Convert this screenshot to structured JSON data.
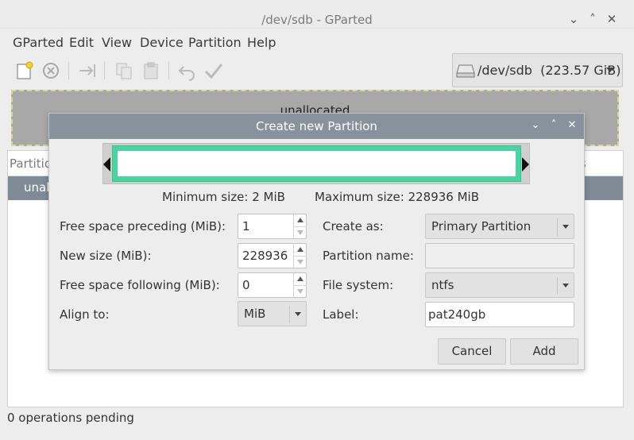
{
  "window": {
    "title": "/dev/sdb - GParted",
    "minimize": "⌄",
    "maximize": "˄",
    "close": "✕"
  },
  "menu": {
    "items": [
      "GParted",
      "Edit",
      "View",
      "Device",
      "Partition",
      "Help"
    ]
  },
  "toolbar": {
    "icons": [
      "new-icon",
      "delete-icon",
      "resize-move-icon",
      "copy-icon",
      "paste-icon",
      "undo-icon",
      "apply-icon"
    ]
  },
  "device": {
    "label": "/dev/sdb  (223.57 GiB)"
  },
  "disk_graphic": {
    "label": "unallocated"
  },
  "list": {
    "header_partition": "Partitio",
    "header_right": "s",
    "row_label": "unal"
  },
  "status": {
    "text": "0 operations pending"
  },
  "dialog": {
    "title": "Create new Partition",
    "min_size": "Minimum size: 2 MiB",
    "max_size": "Maximum size: 228936 MiB",
    "free_preceding_label": "Free space preceding (MiB):",
    "free_preceding_value": "1",
    "new_size_label": "New size (MiB):",
    "new_size_value": "228936",
    "free_following_label": "Free space following (MiB):",
    "free_following_value": "0",
    "align_label": "Align to:",
    "align_value": "MiB",
    "create_as_label": "Create as:",
    "create_as_value": "Primary Partition",
    "partition_name_label": "Partition name:",
    "partition_name_value": "",
    "file_system_label": "File system:",
    "file_system_value": "ntfs",
    "label_label": "Label:",
    "label_value": "pat240gb",
    "cancel": "Cancel",
    "add": "Add",
    "accent_color": "#47d6a0"
  }
}
